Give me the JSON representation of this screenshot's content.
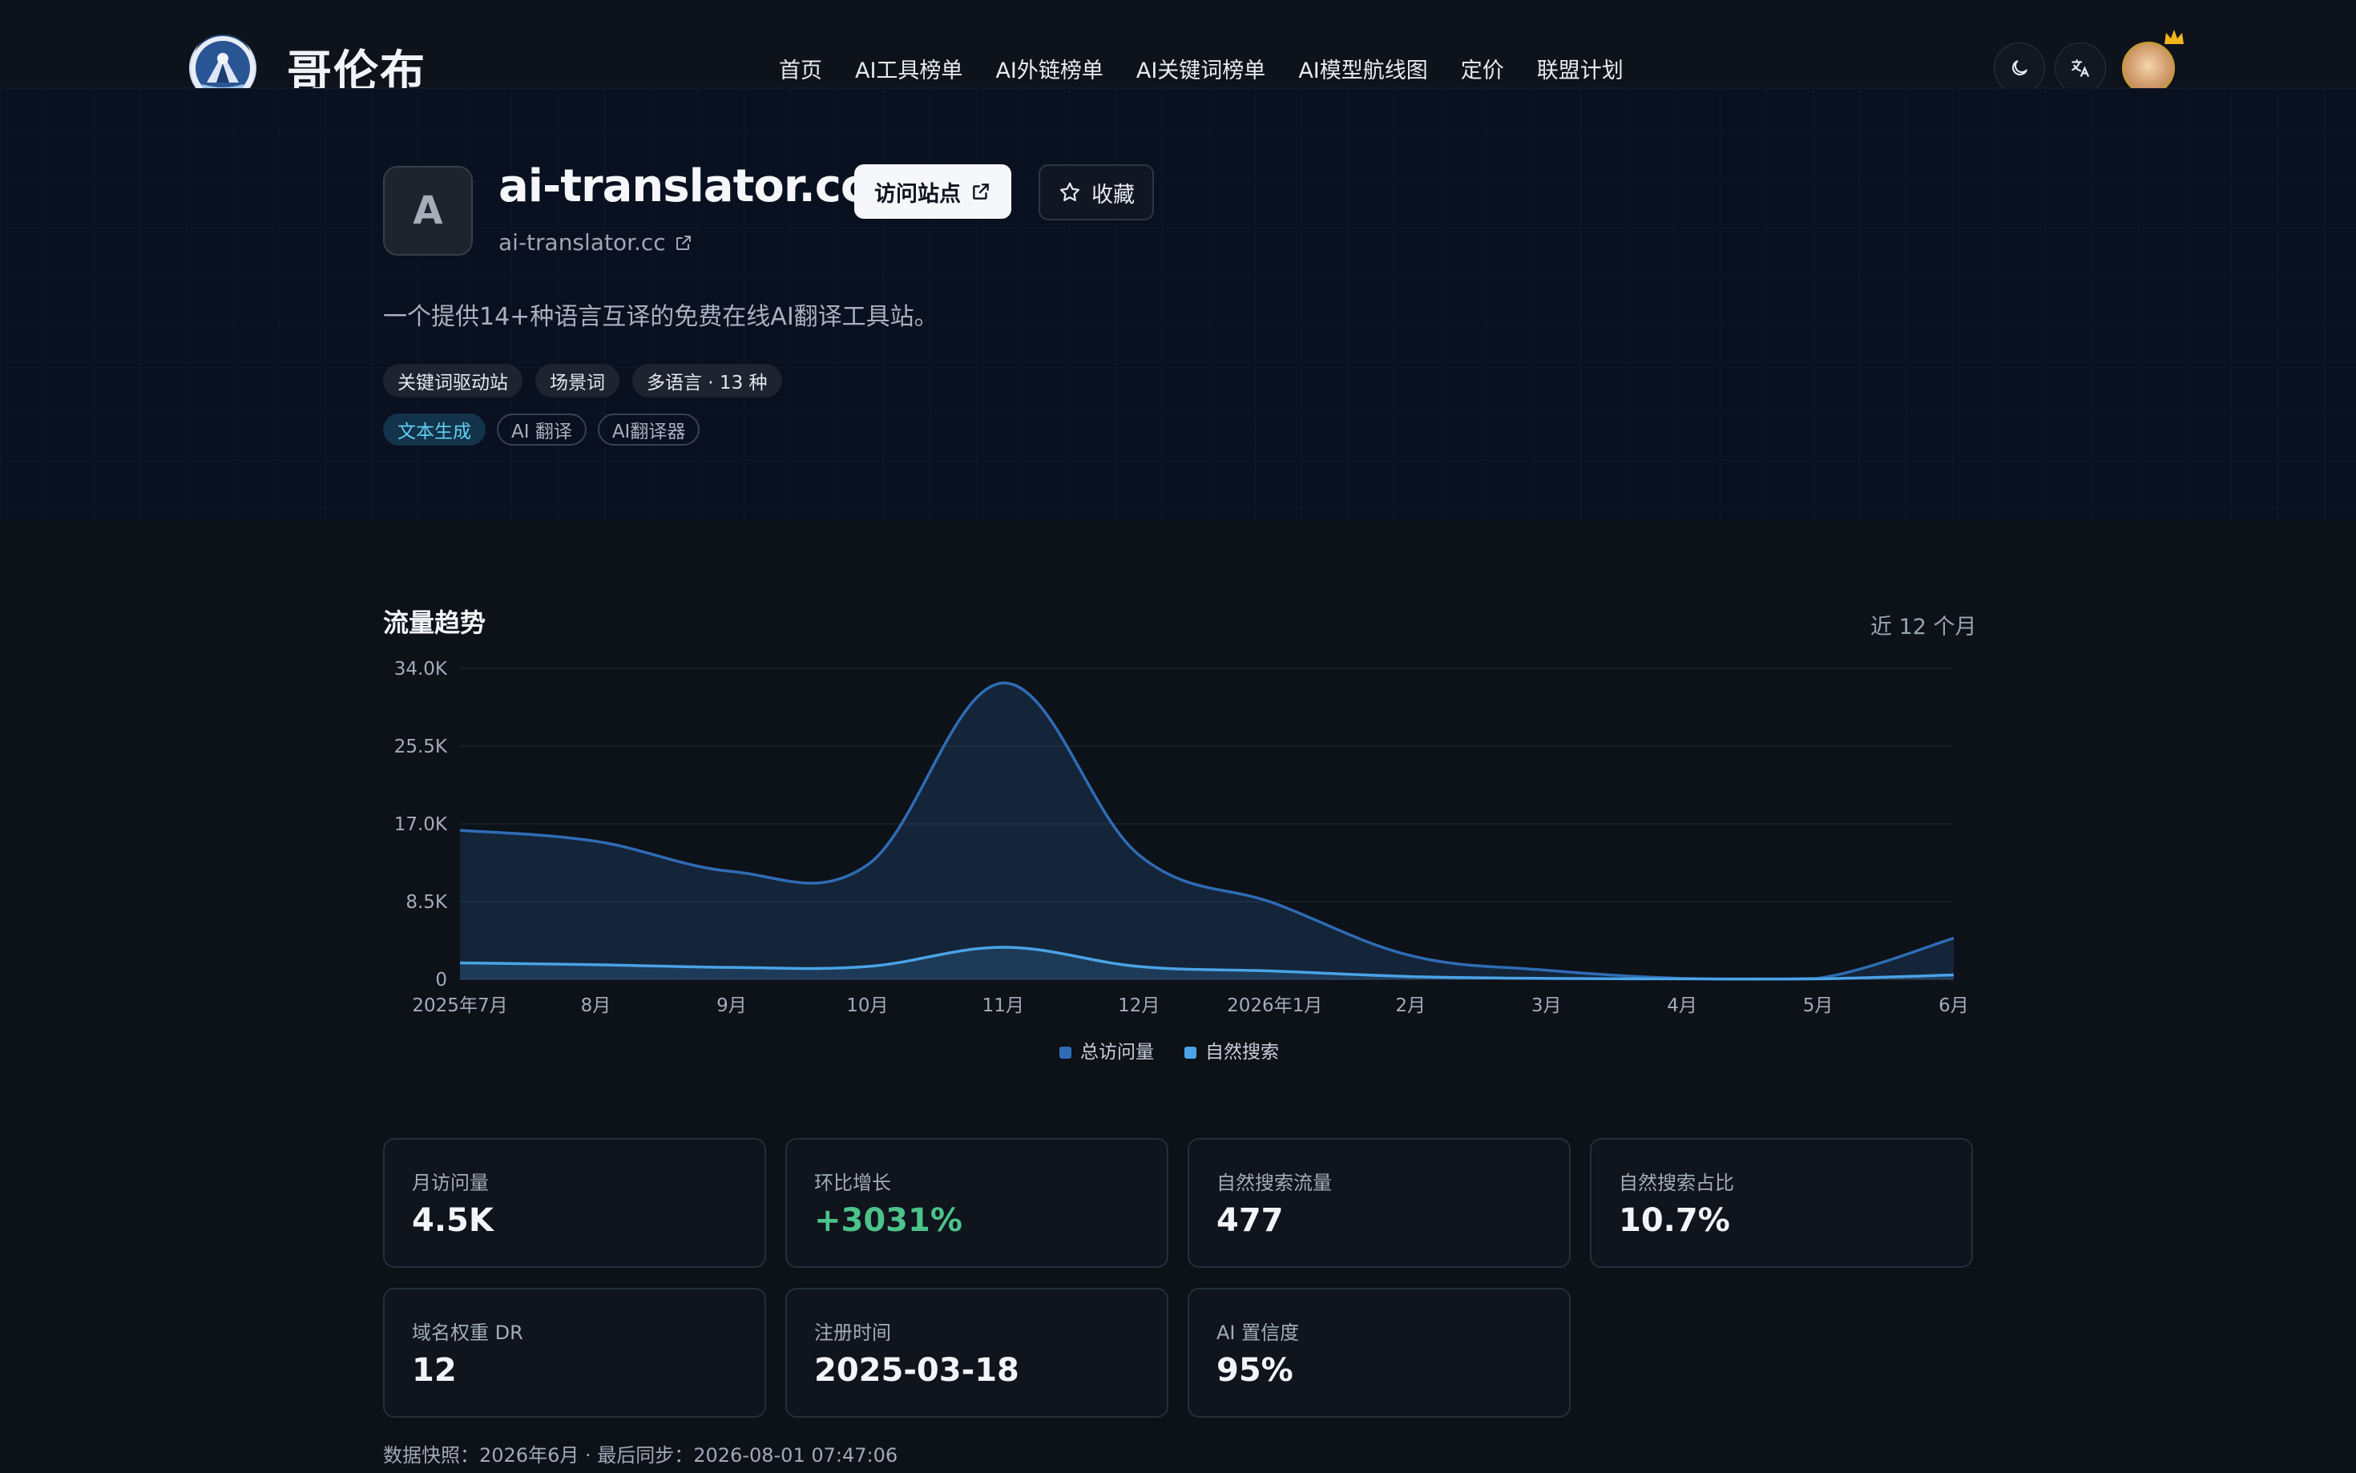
{
  "brand": {
    "name": "哥伦布",
    "logo_icon": "explorer-logo-icon"
  },
  "nav": {
    "links": [
      "首页",
      "AI工具榜单",
      "AI外链榜单",
      "AI关键词榜单",
      "AI模型航线图",
      "定价",
      "联盟计划"
    ],
    "theme_icon": "moon-icon",
    "language_icon": "translate-icon",
    "avatar_badge_icon": "crown-icon"
  },
  "site": {
    "icon_letter": "A",
    "title": "ai-translator.cc",
    "url": "ai-translator.cc",
    "visit_label": "访问站点",
    "favorite_label": "收藏",
    "description": "一个提供14+种语言互译的免费在线AI翻译工具站。",
    "tags_primary": [
      "关键词驱动站",
      "场景词",
      "多语言 · 13 种"
    ],
    "tags_secondary": [
      "文本生成",
      "AI 翻译",
      "AI翻译器"
    ]
  },
  "traffic": {
    "title": "流量趋势",
    "range": "近 12 个月"
  },
  "chart_data": {
    "type": "area",
    "categories": [
      "2025年7月",
      "8月",
      "9月",
      "10月",
      "11月",
      "12月",
      "2026年1月",
      "2月",
      "3月",
      "4月",
      "5月",
      "6月"
    ],
    "yticks": [
      "0",
      "8.5K",
      "17.0K",
      "25.5K",
      "34.0K"
    ],
    "ylim": [
      0,
      34000
    ],
    "grid": true,
    "legend_position": "bottom-center",
    "series": [
      {
        "name": "总访问量",
        "color": "#2f6cb5",
        "values": [
          16300,
          15100,
          11800,
          12500,
          32400,
          13600,
          8300,
          2600,
          1000,
          100,
          100,
          4500
        ]
      },
      {
        "name": "自然搜索",
        "color": "#4aa3e6",
        "values": [
          1800,
          1600,
          1300,
          1400,
          3500,
          1400,
          900,
          300,
          100,
          50,
          50,
          477
        ]
      }
    ]
  },
  "stats": [
    {
      "label": "月访问量",
      "value": "4.5K"
    },
    {
      "label": "环比增长",
      "value": "+3031%",
      "positive": true
    },
    {
      "label": "自然搜索流量",
      "value": "477"
    },
    {
      "label": "自然搜索占比",
      "value": "10.7%"
    },
    {
      "label": "域名权重 DR",
      "value": "12"
    },
    {
      "label": "注册时间",
      "value": "2025-03-18"
    },
    {
      "label": "AI 置信度",
      "value": "95%"
    }
  ],
  "footer": {
    "snapshot": "数据快照：2026年6月 · 最后同步：2026-08-01 07:47:06"
  }
}
